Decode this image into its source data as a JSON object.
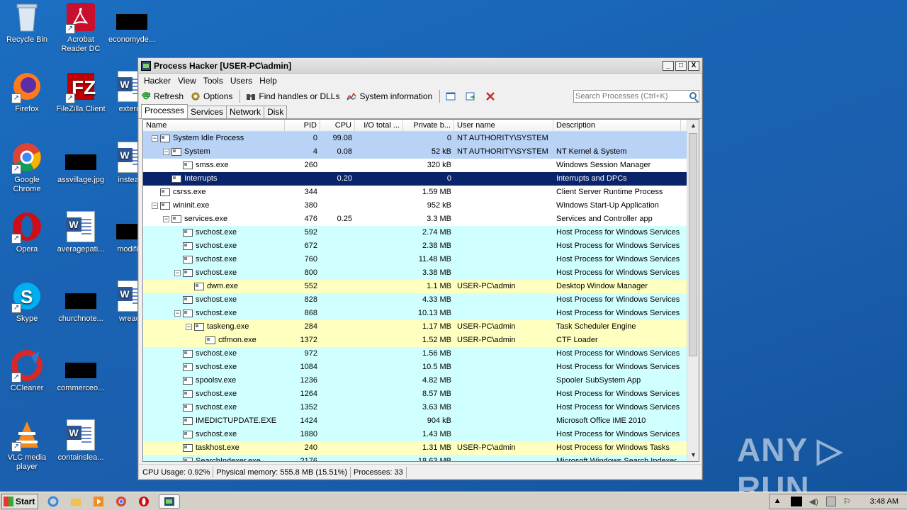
{
  "desktop": {
    "icons": [
      {
        "label": "Recycle Bin"
      },
      {
        "label": "Acrobat Reader DC"
      },
      {
        "label": "economyde..."
      },
      {
        "label": "Firefox"
      },
      {
        "label": "FileZilla Client"
      },
      {
        "label": "externa"
      },
      {
        "label": "Google Chrome"
      },
      {
        "label": "assvillage.jpg"
      },
      {
        "label": "insteadr"
      },
      {
        "label": "Opera"
      },
      {
        "label": "averagepati..."
      },
      {
        "label": "modified"
      },
      {
        "label": "Skype"
      },
      {
        "label": "churchnote..."
      },
      {
        "label": "wreade"
      },
      {
        "label": "CCleaner"
      },
      {
        "label": "commerceo..."
      },
      {
        "label": "VLC media player"
      },
      {
        "label": "containslea..."
      }
    ],
    "watermark": "ANY ▷ RUN"
  },
  "window": {
    "title": "Process Hacker [USER-PC\\admin]",
    "controls": {
      "minimize": "_",
      "maximize": "□",
      "close": "X"
    },
    "menu": [
      "Hacker",
      "View",
      "Tools",
      "Users",
      "Help"
    ],
    "toolbar": {
      "refresh": "Refresh",
      "options": "Options",
      "find": "Find handles or DLLs",
      "sysinfo": "System information"
    },
    "search_placeholder": "Search Processes (Ctrl+K)",
    "tabs": [
      "Processes",
      "Services",
      "Network",
      "Disk"
    ],
    "columns": [
      "Name",
      "PID",
      "CPU",
      "I/O total ...",
      "Private b...",
      "User name",
      "Description"
    ],
    "rows": [
      {
        "name": "System Idle Process",
        "pid": "0",
        "cpu": "99.08",
        "io": "",
        "priv": "0",
        "user": "NT AUTHORITY\\SYSTEM",
        "desc": "",
        "indent": 0,
        "exp": "-",
        "bg": "#b8d3f5"
      },
      {
        "name": "System",
        "pid": "4",
        "cpu": "0.08",
        "io": "",
        "priv": "52 kB",
        "user": "NT AUTHORITY\\SYSTEM",
        "desc": "NT Kernel & System",
        "indent": 1,
        "exp": "-",
        "bg": "#b8d3f5"
      },
      {
        "name": "smss.exe",
        "pid": "260",
        "cpu": "",
        "io": "",
        "priv": "320 kB",
        "user": "",
        "desc": "Windows Session Manager",
        "indent": 2,
        "exp": "",
        "bg": "#ffffff"
      },
      {
        "name": "Interrupts",
        "pid": "",
        "cpu": "0.20",
        "io": "",
        "priv": "0",
        "user": "",
        "desc": "Interrupts and DPCs",
        "indent": 1,
        "exp": "",
        "bg": "#0a246a",
        "sel": true
      },
      {
        "name": "csrss.exe",
        "pid": "344",
        "cpu": "",
        "io": "",
        "priv": "1.59 MB",
        "user": "",
        "desc": "Client Server Runtime Process",
        "indent": 0,
        "exp": "",
        "bg": "#ffffff"
      },
      {
        "name": "wininit.exe",
        "pid": "380",
        "cpu": "",
        "io": "",
        "priv": "952 kB",
        "user": "",
        "desc": "Windows Start-Up Application",
        "indent": 0,
        "exp": "-",
        "bg": "#ffffff"
      },
      {
        "name": "services.exe",
        "pid": "476",
        "cpu": "0.25",
        "io": "",
        "priv": "3.3 MB",
        "user": "",
        "desc": "Services and Controller app",
        "indent": 1,
        "exp": "-",
        "bg": "#ffffff"
      },
      {
        "name": "svchost.exe",
        "pid": "592",
        "cpu": "",
        "io": "",
        "priv": "2.74 MB",
        "user": "",
        "desc": "Host Process for Windows Services",
        "indent": 2,
        "exp": "",
        "bg": "#d0ffff"
      },
      {
        "name": "svchost.exe",
        "pid": "672",
        "cpu": "",
        "io": "",
        "priv": "2.38 MB",
        "user": "",
        "desc": "Host Process for Windows Services",
        "indent": 2,
        "exp": "",
        "bg": "#d0ffff"
      },
      {
        "name": "svchost.exe",
        "pid": "760",
        "cpu": "",
        "io": "",
        "priv": "11.48 MB",
        "user": "",
        "desc": "Host Process for Windows Services",
        "indent": 2,
        "exp": "",
        "bg": "#d0ffff"
      },
      {
        "name": "svchost.exe",
        "pid": "800",
        "cpu": "",
        "io": "",
        "priv": "3.38 MB",
        "user": "",
        "desc": "Host Process for Windows Services",
        "indent": 2,
        "exp": "-",
        "bg": "#d0ffff"
      },
      {
        "name": "dwm.exe",
        "pid": "552",
        "cpu": "",
        "io": "",
        "priv": "1.1 MB",
        "user": "USER-PC\\admin",
        "desc": "Desktop Window Manager",
        "indent": 3,
        "exp": "",
        "bg": "#ffffc0"
      },
      {
        "name": "svchost.exe",
        "pid": "828",
        "cpu": "",
        "io": "",
        "priv": "4.33 MB",
        "user": "",
        "desc": "Host Process for Windows Services",
        "indent": 2,
        "exp": "",
        "bg": "#d0ffff"
      },
      {
        "name": "svchost.exe",
        "pid": "868",
        "cpu": "",
        "io": "",
        "priv": "10.13 MB",
        "user": "",
        "desc": "Host Process for Windows Services",
        "indent": 2,
        "exp": "-",
        "bg": "#d0ffff"
      },
      {
        "name": "taskeng.exe",
        "pid": "284",
        "cpu": "",
        "io": "",
        "priv": "1.17 MB",
        "user": "USER-PC\\admin",
        "desc": "Task Scheduler Engine",
        "indent": 3,
        "exp": "-",
        "bg": "#ffffc0"
      },
      {
        "name": "ctfmon.exe",
        "pid": "1372",
        "cpu": "",
        "io": "",
        "priv": "1.52 MB",
        "user": "USER-PC\\admin",
        "desc": "CTF Loader",
        "indent": 4,
        "exp": "",
        "bg": "#ffffc0"
      },
      {
        "name": "svchost.exe",
        "pid": "972",
        "cpu": "",
        "io": "",
        "priv": "1.56 MB",
        "user": "",
        "desc": "Host Process for Windows Services",
        "indent": 2,
        "exp": "",
        "bg": "#d0ffff"
      },
      {
        "name": "svchost.exe",
        "pid": "1084",
        "cpu": "",
        "io": "",
        "priv": "10.5 MB",
        "user": "",
        "desc": "Host Process for Windows Services",
        "indent": 2,
        "exp": "",
        "bg": "#d0ffff"
      },
      {
        "name": "spoolsv.exe",
        "pid": "1236",
        "cpu": "",
        "io": "",
        "priv": "4.82 MB",
        "user": "",
        "desc": "Spooler SubSystem App",
        "indent": 2,
        "exp": "",
        "bg": "#d0ffff"
      },
      {
        "name": "svchost.exe",
        "pid": "1264",
        "cpu": "",
        "io": "",
        "priv": "8.57 MB",
        "user": "",
        "desc": "Host Process for Windows Services",
        "indent": 2,
        "exp": "",
        "bg": "#d0ffff"
      },
      {
        "name": "svchost.exe",
        "pid": "1352",
        "cpu": "",
        "io": "",
        "priv": "3.63 MB",
        "user": "",
        "desc": "Host Process for Windows Services",
        "indent": 2,
        "exp": "",
        "bg": "#d0ffff"
      },
      {
        "name": "IMEDICTUPDATE.EXE",
        "pid": "1424",
        "cpu": "",
        "io": "",
        "priv": "904 kB",
        "user": "",
        "desc": "Microsoft Office IME 2010",
        "indent": 2,
        "exp": "",
        "bg": "#d0ffff"
      },
      {
        "name": "svchost.exe",
        "pid": "1880",
        "cpu": "",
        "io": "",
        "priv": "1.43 MB",
        "user": "",
        "desc": "Host Process for Windows Services",
        "indent": 2,
        "exp": "",
        "bg": "#d0ffff"
      },
      {
        "name": "taskhost.exe",
        "pid": "240",
        "cpu": "",
        "io": "",
        "priv": "1.31 MB",
        "user": "USER-PC\\admin",
        "desc": "Host Process for Windows Tasks",
        "indent": 2,
        "exp": "",
        "bg": "#ffffc0"
      },
      {
        "name": "SearchIndexer.exe",
        "pid": "2176",
        "cpu": "",
        "io": "",
        "priv": "18.63 MB",
        "user": "",
        "desc": "Microsoft Windows Search Indexer",
        "indent": 2,
        "exp": "",
        "bg": "#d0ffff"
      }
    ],
    "status": {
      "cpu": "CPU Usage: 0.92%",
      "memory": "Physical memory: 555.8 MB (15.51%)",
      "processes": "Processes: 33"
    }
  },
  "taskbar": {
    "start": "Start",
    "clock": "3:48 AM"
  }
}
